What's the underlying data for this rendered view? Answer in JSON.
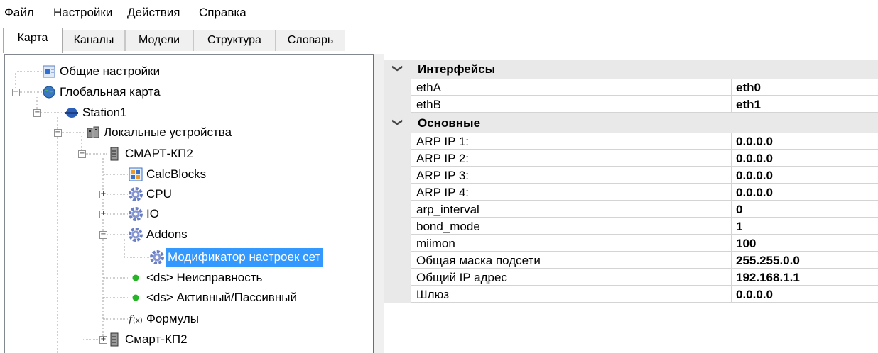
{
  "menu": [
    "Файл",
    "Настройки",
    "Действия",
    "Справка"
  ],
  "tabs": [
    "Карта",
    "Каналы",
    "Модели",
    "Структура",
    "Словарь"
  ],
  "tree": [
    {
      "label": "Общие настройки",
      "icon": "settings-doc-icon"
    },
    {
      "label": "Глобальная карта",
      "icon": "globe-icon"
    },
    {
      "label": "Station1",
      "icon": "station-icon"
    },
    {
      "label": "Локальные устройства",
      "icon": "devices-icon"
    },
    {
      "label": "СМАРТ-КП2",
      "icon": "server-icon"
    },
    {
      "label": "CalcBlocks",
      "icon": "calc-blocks-icon"
    },
    {
      "label": "CPU",
      "icon": "gear-icon"
    },
    {
      "label": "IO",
      "icon": "gear-icon"
    },
    {
      "label": "Addons",
      "icon": "gear-icon"
    },
    {
      "label": "Модификатор настроек сет",
      "icon": "gear-icon",
      "selected": true
    },
    {
      "label": "<ds> Неисправность",
      "icon": "green-dot-icon"
    },
    {
      "label": "<ds> Активный/Пассивный",
      "icon": "green-dot-icon"
    },
    {
      "label": "Формулы",
      "icon": "formula-icon"
    },
    {
      "label": "Смарт-КП2",
      "icon": "server-icon"
    }
  ],
  "properties": {
    "interfaces": {
      "title": "Интерфейсы",
      "rows": [
        {
          "name": "ethA",
          "value": "eth0"
        },
        {
          "name": "ethB",
          "value": "eth1"
        }
      ]
    },
    "basic": {
      "title": "Основные",
      "rows": [
        {
          "name": "ARP IP 1:",
          "value": "0.0.0.0"
        },
        {
          "name": "ARP IP 2:",
          "value": "0.0.0.0"
        },
        {
          "name": "ARP IP 3:",
          "value": "0.0.0.0"
        },
        {
          "name": "ARP IP 4:",
          "value": "0.0.0.0"
        },
        {
          "name": "arp_interval",
          "value": "0"
        },
        {
          "name": "bond_mode",
          "value": "1"
        },
        {
          "name": "miimon",
          "value": "100"
        },
        {
          "name": "Общая маска подсети",
          "value": "255.255.0.0"
        },
        {
          "name": "Общий IP адрес",
          "value": "192.168.1.1"
        },
        {
          "name": "Шлюз",
          "value": "0.0.0.0"
        }
      ]
    }
  },
  "colors": {
    "selection": "#3399ff",
    "category_bg": "#e9e9e9",
    "dot": "#27b427",
    "gear": "#6b7fc4"
  }
}
